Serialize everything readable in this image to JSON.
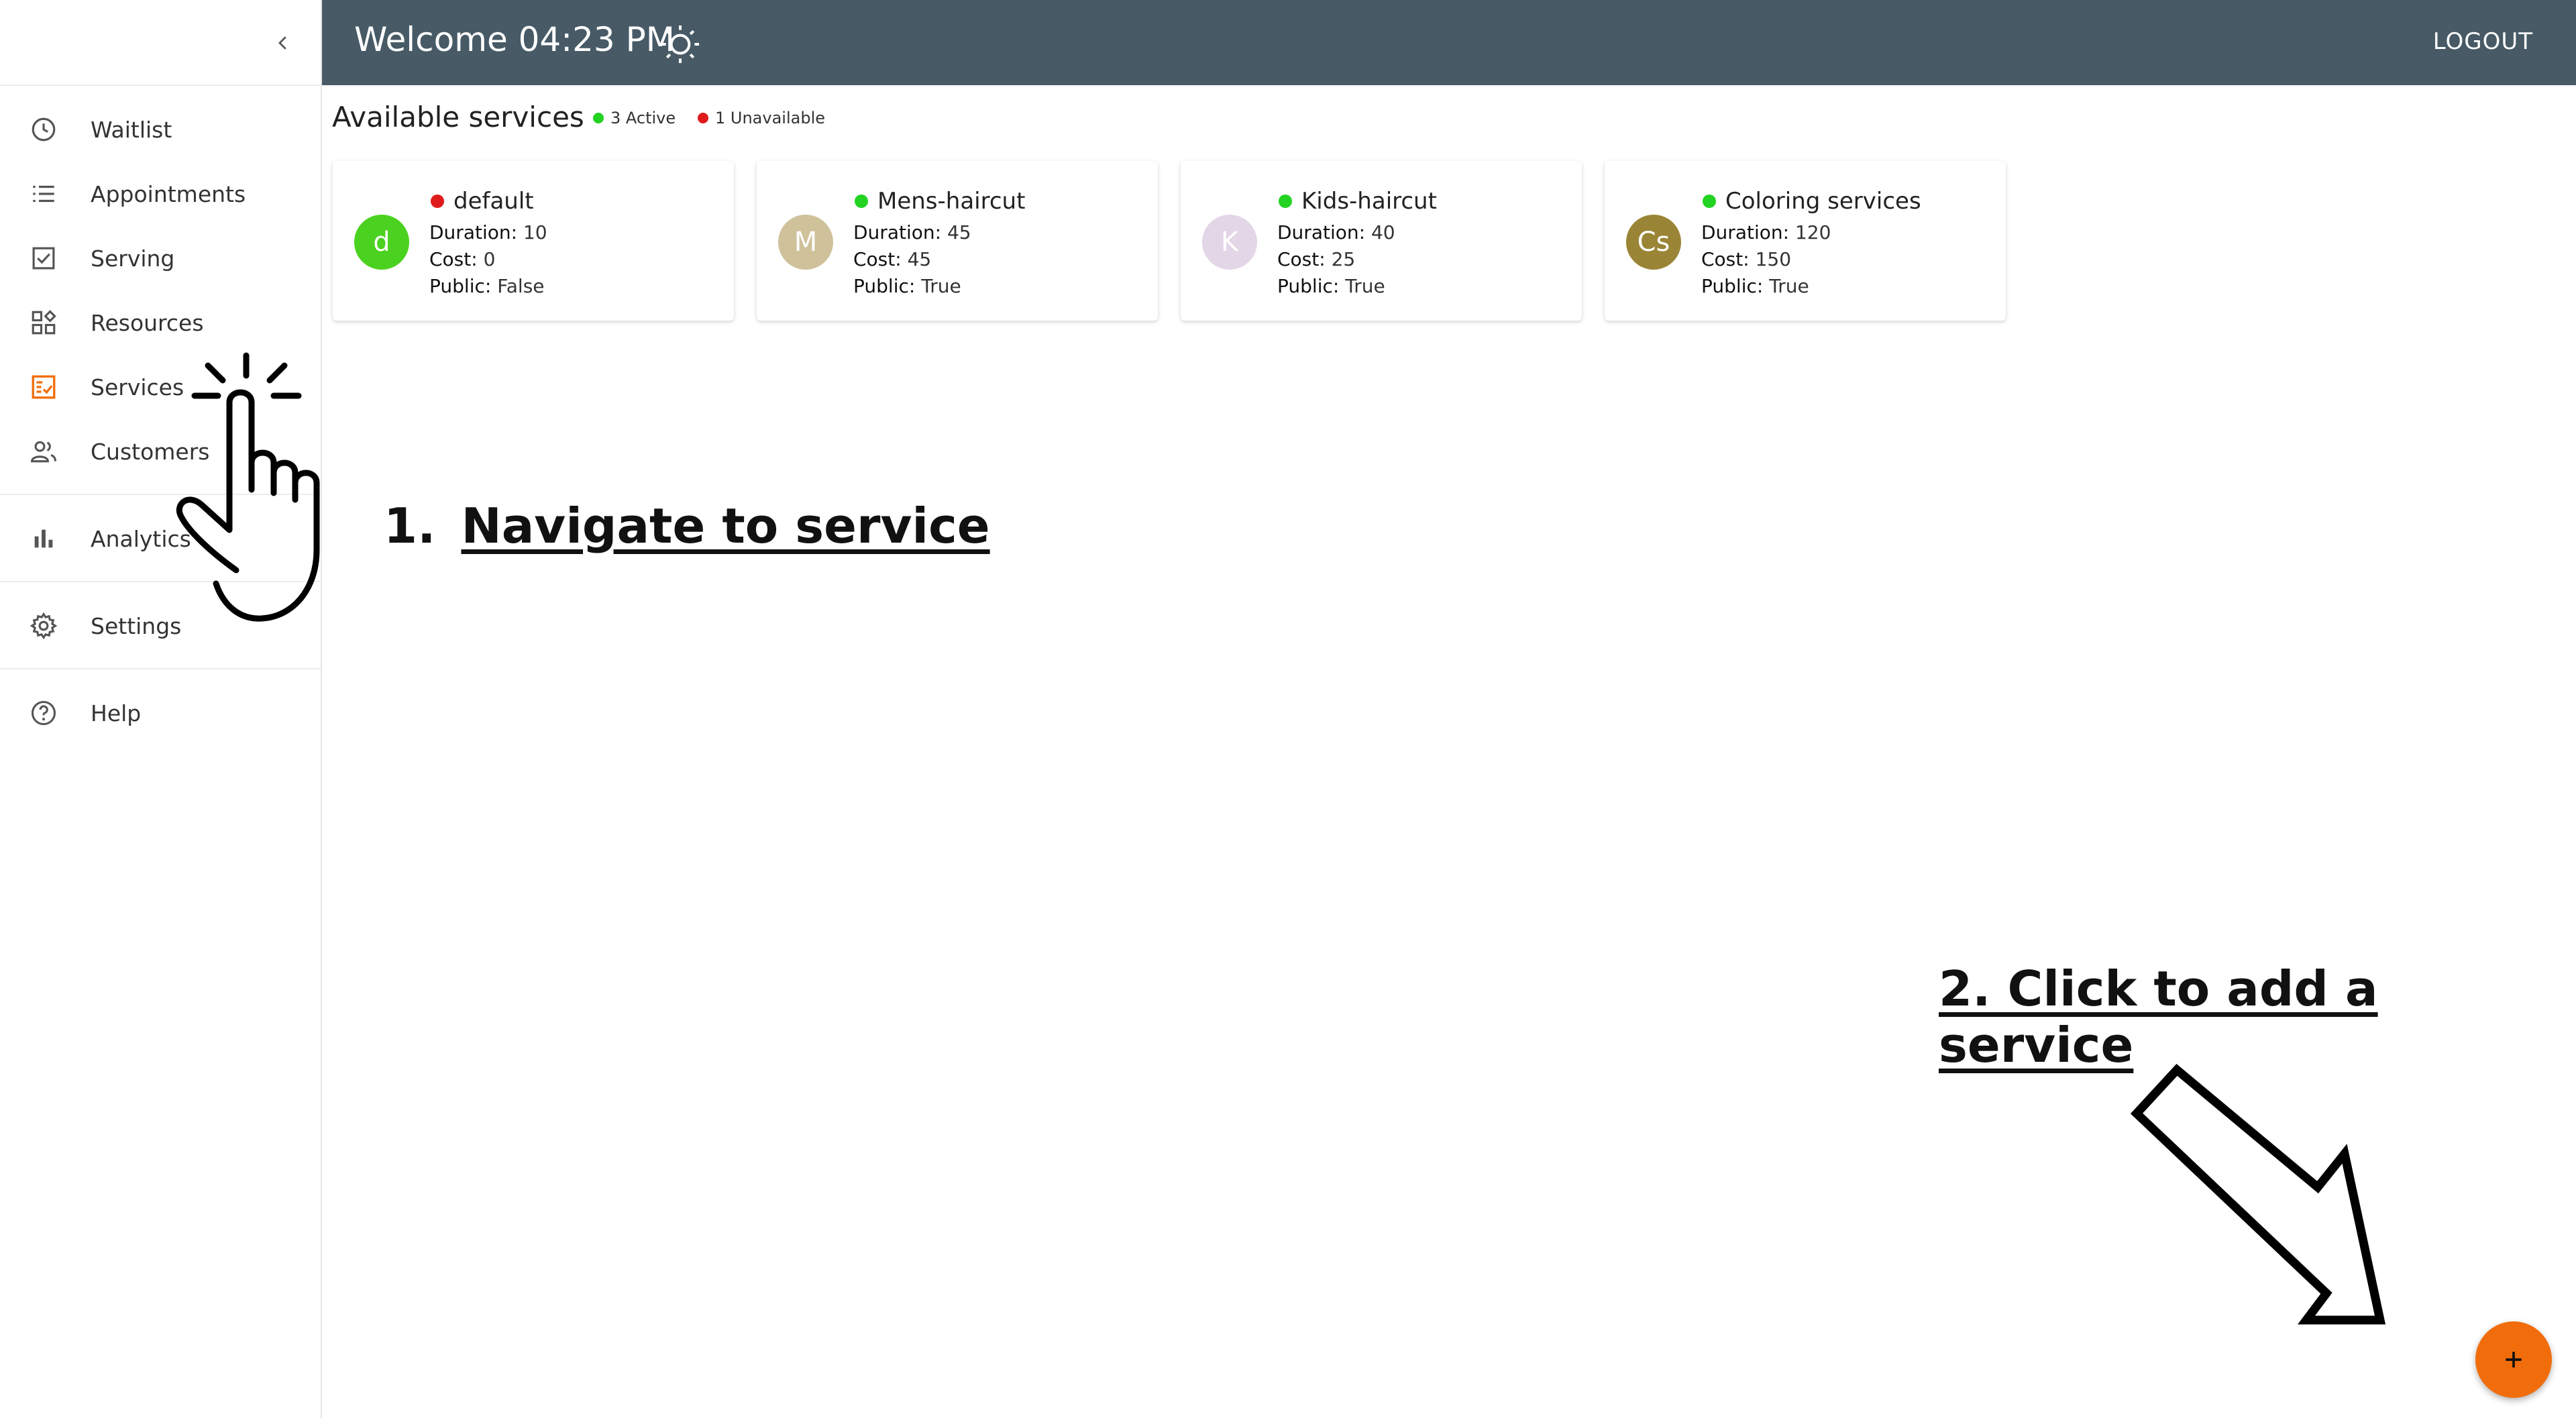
{
  "sidebar": {
    "items": [
      {
        "label": "Waitlist",
        "icon": "clock-icon"
      },
      {
        "label": "Appointments",
        "icon": "list-icon"
      },
      {
        "label": "Serving",
        "icon": "checkbox-icon"
      },
      {
        "label": "Resources",
        "icon": "widgets-icon"
      },
      {
        "label": "Services",
        "icon": "services-icon",
        "active": true
      },
      {
        "label": "Customers",
        "icon": "people-icon"
      },
      {
        "label": "Analytics",
        "icon": "bar-chart-icon"
      },
      {
        "label": "Settings",
        "icon": "gear-icon"
      },
      {
        "label": "Help",
        "icon": "help-icon"
      }
    ]
  },
  "header": {
    "welcome": "Welcome 04:23 PM",
    "logout": "LOGOUT"
  },
  "main": {
    "title": "Available services",
    "legend": {
      "active": "3 Active",
      "unavailable": "1 Unavailable"
    },
    "cards": [
      {
        "initial": "d",
        "name": "default",
        "status": "unavailable",
        "duration": "10",
        "cost": "0",
        "public": "False",
        "avatar_color": "#4bd11f"
      },
      {
        "initial": "M",
        "name": "Mens-haircut",
        "status": "active",
        "duration": "45",
        "cost": "45",
        "public": "True",
        "avatar_color": "#cfc19a"
      },
      {
        "initial": "K",
        "name": "Kids-haircut",
        "status": "active",
        "duration": "40",
        "cost": "25",
        "public": "True",
        "avatar_color": "#e3d6e6"
      },
      {
        "initial": "Cs",
        "name": "Coloring services",
        "status": "active",
        "duration": "120",
        "cost": "150",
        "public": "True",
        "avatar_color": "#9a8536"
      }
    ],
    "field_labels": {
      "duration": "Duration:",
      "cost": "Cost:",
      "public": "Public:"
    }
  },
  "annotations": {
    "step1_num": "1.",
    "step1_text": "Navigate to service",
    "step2_text": "2. Click to add a service"
  },
  "colors": {
    "topbar": "#475a66",
    "accent": "#f16d0c",
    "active_dot": "#22d322",
    "unavailable_dot": "#e01b1b"
  }
}
